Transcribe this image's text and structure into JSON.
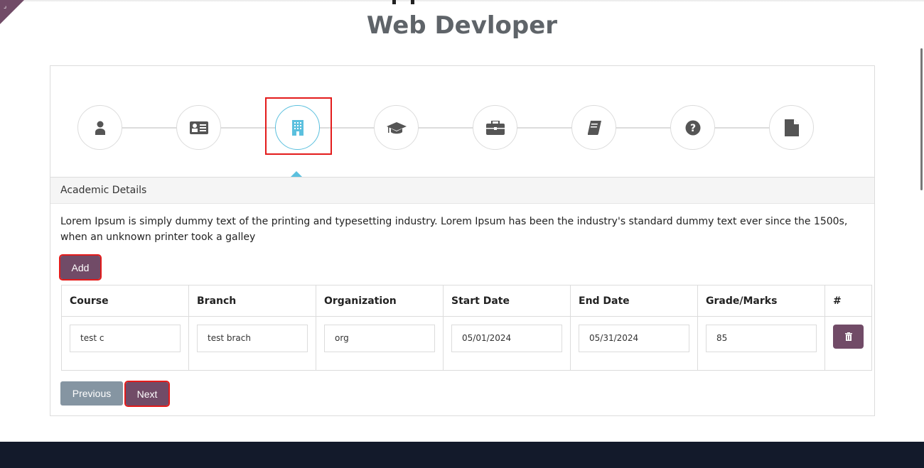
{
  "header": {
    "title": "Web Devloper"
  },
  "steps": [
    {
      "icon": "user-icon"
    },
    {
      "icon": "id-card-icon"
    },
    {
      "icon": "building-icon",
      "active": true
    },
    {
      "icon": "graduation-cap-icon"
    },
    {
      "icon": "briefcase-icon"
    },
    {
      "icon": "book-icon"
    },
    {
      "icon": "question-circle-icon"
    },
    {
      "icon": "file-icon"
    }
  ],
  "section": {
    "title": "Academic Details",
    "description": "Lorem Ipsum is simply dummy text of the printing and typesetting industry. Lorem Ipsum has been the industry's standard dummy text ever since the 1500s, when an unknown printer took a galley",
    "add_label": "Add"
  },
  "table": {
    "headers": [
      "Course",
      "Branch",
      "Organization",
      "Start Date",
      "End Date",
      "Grade/Marks",
      "#"
    ],
    "rows": [
      [
        "test c",
        "test brach",
        "org",
        "05/01/2024",
        "05/31/2024",
        "85"
      ]
    ]
  },
  "nav": {
    "previous_label": "Previous",
    "next_label": "Next"
  },
  "colors": {
    "accent": "#714b67",
    "active": "#5bc0de",
    "footer": "#131a2b"
  }
}
